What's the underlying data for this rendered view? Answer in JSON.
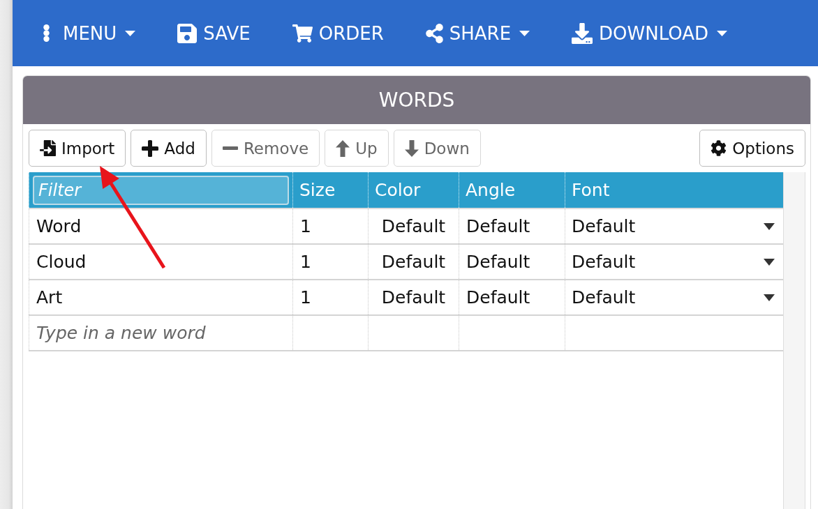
{
  "nav": [
    {
      "label": "MENU",
      "dropdown": true
    },
    {
      "label": "SAVE",
      "dropdown": false
    },
    {
      "label": "ORDER",
      "dropdown": false
    },
    {
      "label": "SHARE",
      "dropdown": true
    },
    {
      "label": "DOWNLOAD",
      "dropdown": true
    }
  ],
  "panel": {
    "title": "WORDS"
  },
  "toolbar": {
    "buttons": [
      {
        "label": "Import",
        "disabled": false
      },
      {
        "label": "Add",
        "disabled": false
      },
      {
        "label": "Remove",
        "disabled": true
      },
      {
        "label": "Up",
        "disabled": true
      },
      {
        "label": "Down",
        "disabled": true
      }
    ],
    "options": {
      "label": "Options",
      "disabled": false
    }
  },
  "table": {
    "filter": {
      "placeholder": "Filter"
    },
    "columns": [
      "Size",
      "Color",
      "Angle",
      "Font"
    ],
    "rows": [
      {
        "word": "Word",
        "size": "1",
        "colour": "Default",
        "angle": "Default",
        "font": "Default"
      },
      {
        "word": "Cloud",
        "size": "1",
        "colour": "Default",
        "angle": "Default",
        "font": "Default"
      },
      {
        "word": "Art",
        "size": "1",
        "colour": "Default",
        "angle": "Default",
        "font": "Default"
      }
    ],
    "new_word": {
      "placeholder": "Type in a new word"
    }
  }
}
